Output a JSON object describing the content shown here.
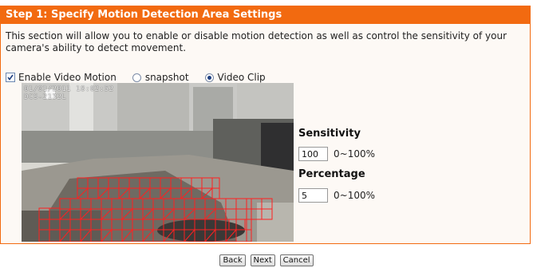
{
  "header": {
    "title": "Step 1: Specify Motion Detection Area Settings"
  },
  "description": "This section will allow you to enable or disable motion detection as well as control the sensitivity of your camera's ability to detect movement.",
  "options": {
    "enable_label": "Enable Video Motion",
    "enable_checked": true,
    "snapshot_label": "snapshot",
    "snapshot_selected": false,
    "videoclip_label": "Video Clip",
    "videoclip_selected": true
  },
  "video": {
    "osd_line1": "01/01/2011 18:02:52",
    "osd_line2": "DCS-2132L"
  },
  "sensitivity": {
    "label": "Sensitivity",
    "value": "100",
    "range": "0~100%"
  },
  "percentage": {
    "label": "Percentage",
    "value": "5",
    "range": "0~100%"
  },
  "buttons": {
    "back": "Back",
    "next": "Next",
    "cancel": "Cancel"
  },
  "colors": {
    "accent": "#f26a10",
    "grid": "#ff2020",
    "radio_selected": "#1e3f80"
  }
}
